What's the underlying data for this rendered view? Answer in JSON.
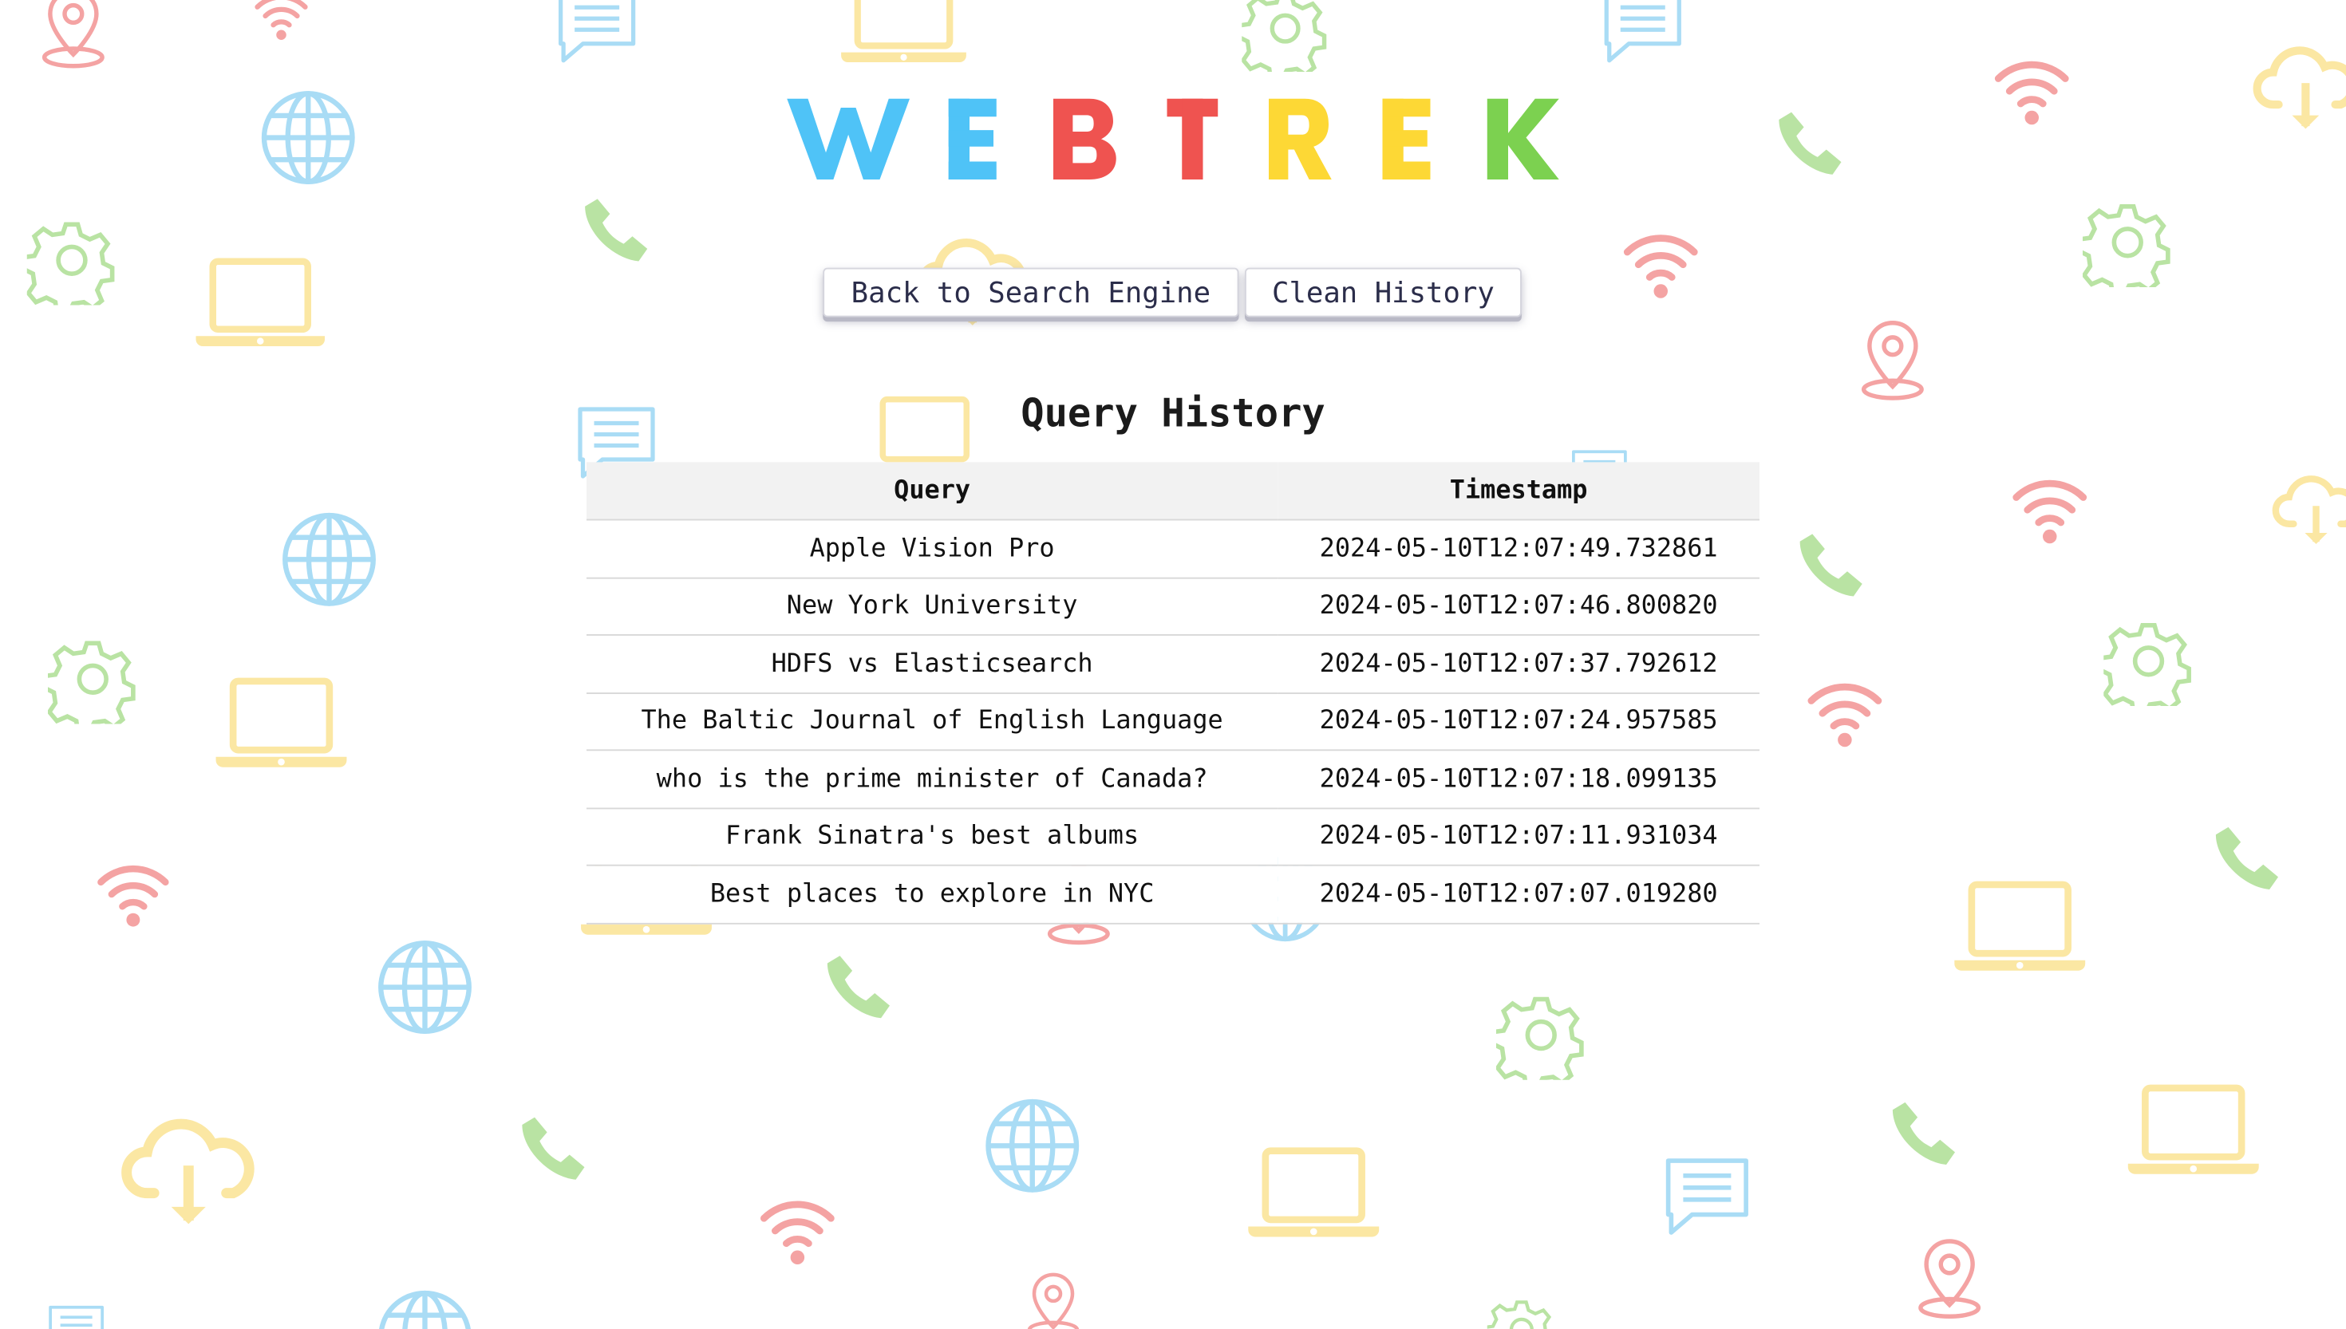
{
  "app": {
    "logo_letters": [
      "W",
      "E",
      "B",
      "T",
      "R",
      "E",
      "K"
    ],
    "logo_colors": [
      "#4fc3f7",
      "#4fc3f7",
      "#ef5350",
      "#ef5350",
      "#fdd835",
      "#fdd835",
      "#7cd150"
    ]
  },
  "toolbar": {
    "back_label": "Back to Search Engine",
    "clean_label": "Clean History"
  },
  "history": {
    "title": "Query History",
    "columns": [
      "Query",
      "Timestamp"
    ],
    "rows": [
      {
        "query": "Apple Vision Pro",
        "timestamp": "2024-05-10T12:07:49.732861"
      },
      {
        "query": "New York University",
        "timestamp": "2024-05-10T12:07:46.800820"
      },
      {
        "query": "HDFS vs Elasticsearch",
        "timestamp": "2024-05-10T12:07:37.792612"
      },
      {
        "query": "The Baltic Journal of English Language",
        "timestamp": "2024-05-10T12:07:24.957585"
      },
      {
        "query": "who is the prime minister of Canada?",
        "timestamp": "2024-05-10T12:07:18.099135"
      },
      {
        "query": "Frank Sinatra's best albums",
        "timestamp": "2024-05-10T12:07:11.931034"
      },
      {
        "query": "Best places to explore in NYC",
        "timestamp": "2024-05-10T12:07:07.019280"
      }
    ]
  },
  "background": {
    "icon_names": [
      "map-pin-icon",
      "wifi-icon",
      "chat-bubble-icon",
      "laptop-icon",
      "gear-icon",
      "globe-icon",
      "phone-icon",
      "cloud-download-icon"
    ],
    "colors": {
      "pin": "#f4a3a3",
      "wifi": "#f4a3a3",
      "chat": "#a9dcf5",
      "globe": "#a9dcf5",
      "laptop": "#fbe7a3",
      "cloud": "#fbe7a3",
      "gear": "#b9e3a3",
      "phone": "#b9e3a3"
    }
  }
}
